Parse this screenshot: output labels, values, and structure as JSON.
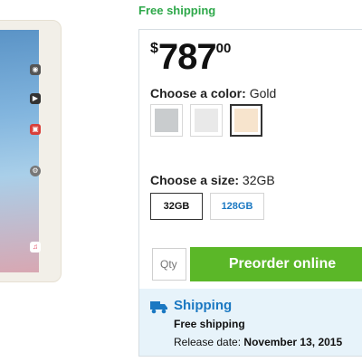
{
  "header": {
    "free_shipping": "Free shipping"
  },
  "price": {
    "currency": "$",
    "main": "787",
    "cents": "00"
  },
  "color": {
    "label": "Choose a color:",
    "selected": "Gold",
    "options": [
      {
        "name": "Space Gray",
        "hex": "#c9ccce"
      },
      {
        "name": "Silver",
        "hex": "#e9e9e9"
      },
      {
        "name": "Gold",
        "hex": "#f7e4cd"
      }
    ]
  },
  "size": {
    "label": "Choose a size:",
    "selected": "32GB",
    "options": [
      "32GB",
      "128GB"
    ]
  },
  "purchase": {
    "qty_placeholder": "Qty",
    "button_label": "Preorder online",
    "button_color": "#5bb728"
  },
  "shipping": {
    "title": "Shipping",
    "method": "Free shipping",
    "release_label": "Release date:",
    "release_date": "November 13, 2015"
  },
  "colors": {
    "accent_green": "#2ea84a",
    "accent_blue": "#1a78c2",
    "ship_bg": "#e7f3fa"
  }
}
